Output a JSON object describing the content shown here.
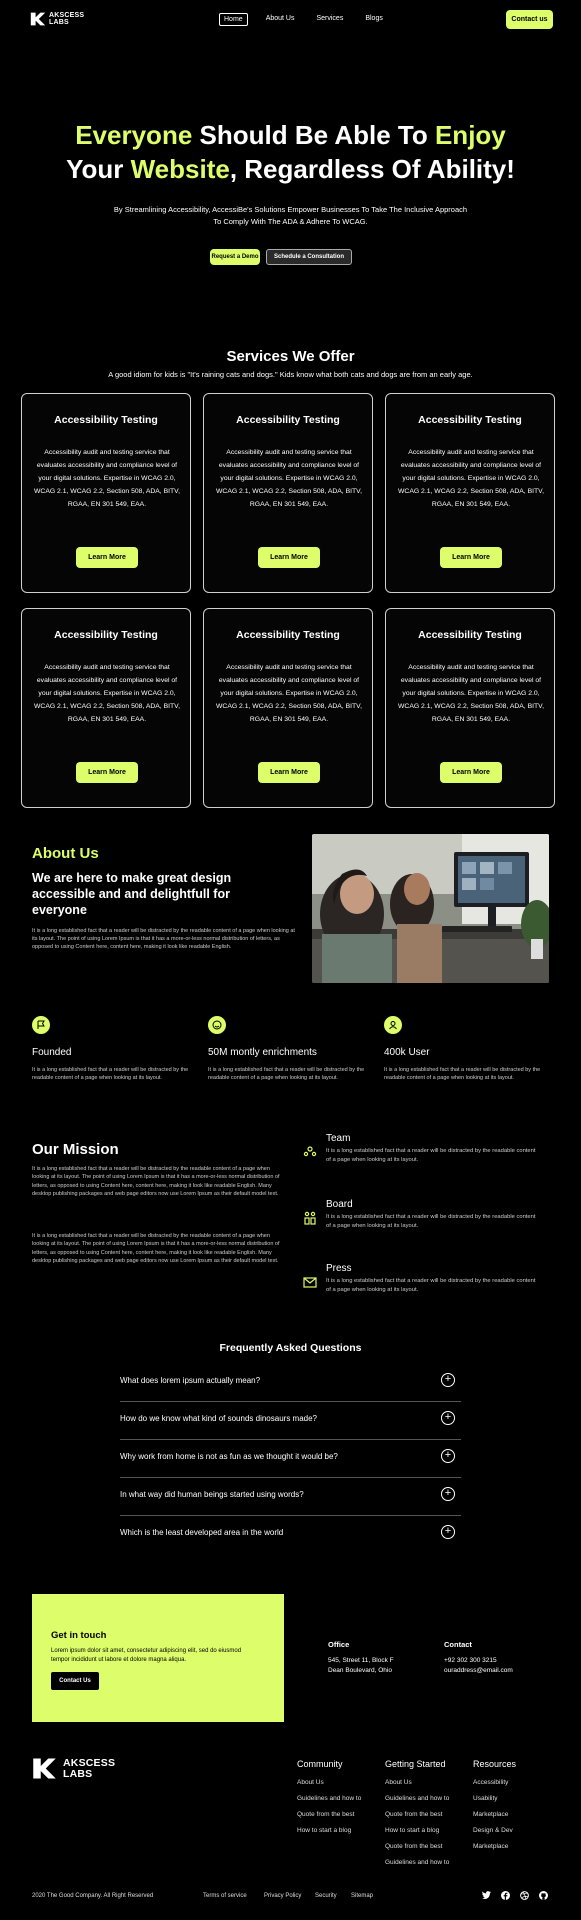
{
  "brand": {
    "line1": "AKSCESS",
    "line2": "LABS"
  },
  "nav": {
    "links": [
      "Home",
      "About Us",
      "Services",
      "Blogs"
    ],
    "contact_label": "Contact us"
  },
  "hero": {
    "line1_a": "Everyone",
    "line1_b": " Should Be Able To ",
    "line1_c": "Enjoy",
    "line2_a": "Your ",
    "line2_b": "Website",
    "line2_c": ", Regardless Of Ability!",
    "subtitle": "By Streamlining Accessibility, AccessiBe's Solutions Empower Businesses To Take The Inclusive Approach To Comply With The ADA & Adhere To WCAG.",
    "demo_label": "Request a Demo",
    "consult_label": "Schedule a Consultation"
  },
  "services": {
    "title": "Services We Offer",
    "subtitle": "A good idiom for kids is \"It's raining cats and dogs.\" Kids know what both cats and dogs are from an early age.",
    "cards": [
      {
        "title": "Accessibility Testing",
        "body": "Accessibility audit and testing service that evaluates accessibility and compliance level of your digital solutions. Expertise in WCAG 2.0, WCAG 2.1, WCAG 2.2, Section 508, ADA, BITV, RGAA, EN 301 549, EAA.",
        "button": "Learn More"
      },
      {
        "title": "Accessibility Testing",
        "body": "Accessibility audit and testing service that evaluates accessibility and compliance level of your digital solutions. Expertise in WCAG 2.0, WCAG 2.1, WCAG 2.2, Section 508, ADA, BITV, RGAA, EN 301 549, EAA.",
        "button": "Learn More"
      },
      {
        "title": "Accessibility Testing",
        "body": "Accessibility audit and testing service that evaluates accessibility and compliance level of your digital solutions. Expertise in WCAG 2.0, WCAG 2.1, WCAG 2.2, Section 508, ADA, BITV, RGAA, EN 301 549, EAA.",
        "button": "Learn More"
      },
      {
        "title": "Accessibility Testing",
        "body": "Accessibility audit and testing service that evaluates accessibility and compliance level of your digital solutions. Expertise in WCAG 2.0, WCAG 2.1, WCAG 2.2, Section 508, ADA, BITV, RGAA, EN 301 549, EAA.",
        "button": "Learn More"
      },
      {
        "title": "Accessibility Testing",
        "body": "Accessibility audit and testing service that evaluates accessibility and compliance level of your digital solutions. Expertise in WCAG 2.0, WCAG 2.1, WCAG 2.2, Section 508, ADA, BITV, RGAA, EN 301 549, EAA.",
        "button": "Learn More"
      },
      {
        "title": "Accessibility Testing",
        "body": "Accessibility audit and testing service that evaluates accessibility and compliance level of your digital solutions. Expertise in WCAG 2.0, WCAG 2.1, WCAG 2.2, Section 508, ADA, BITV, RGAA, EN 301 549, EAA.",
        "button": "Learn More"
      }
    ]
  },
  "about": {
    "heading": "About Us",
    "title": "We are here to make great design accessible and and delightfull for everyone",
    "text": "It is a long established fact that a reader will be distracted by the readable content of a page when looking at its layout. The point of using Lorem Ipsum is that it has a more-or-less normal distribution of letters, as opposed to using Content here, content here, making it look like readable English."
  },
  "stats": [
    {
      "title": "Founded",
      "text": "It is a long established fact that a reader will be distracted by the readable content of a page when looking at its layout."
    },
    {
      "title": "50M montly enrichments",
      "text": "It is a long established fact that a reader will be distracted by the readable content of a page when looking at its layout."
    },
    {
      "title": "400k User",
      "text": "It is a long established fact that a reader will be distracted by the readable content of a page when looking at its layout."
    }
  ],
  "mission": {
    "title": "Our Mission",
    "paragraph1": "It is a long established fact that a reader will be distracted by the readable content of a page when looking at its layout. The point of using Lorem Ipsum is that it has a more-or-less normal distribution of letters, as opposed to using Content here, content here, making it look like readable English. Many desktop publishing packages and web page editors now use Lorem Ipsum as their default model text.",
    "paragraph2": "It is a long established fact that a reader will be distracted by the readable content of a page when looking at its layout. The point of using Lorem Ipsum is that it has a more-or-less normal distribution of letters, as opposed to using Content here, content here, making it look like readable English. Many desktop publishing packages and web page editors now use Lorem Ipsum as their default model text.",
    "features": [
      {
        "title": "Team",
        "text": "It is a long established fact that a reader will be distracted by the readable content of a page when looking at its layout."
      },
      {
        "title": "Board",
        "text": "It is a long established fact that a reader will be distracted by the readable content of a page when looking at its layout."
      },
      {
        "title": "Press",
        "text": "It is a long established fact that a reader will be distracted by the readable content of a page when looking at its layout."
      }
    ]
  },
  "faq": {
    "title": "Frequently Asked Questions",
    "items": [
      "What does lorem ipsum actually mean?",
      "How do we know what kind of sounds dinosaurs made?",
      "Why work from home is not as fun as we thought it would be?",
      "In what way did human beings started using words?",
      "Which is the least developed area in the world"
    ]
  },
  "touch": {
    "title": "Get in touch",
    "text": "Lorem ipsum dolor sit amet, consectetur adipiscing elit, sed do eiusmod tempor incididunt ut labore et dolore magna aliqua.",
    "button": "Contact Us"
  },
  "office": {
    "label": "Office",
    "line1": "545, Street 11, Block F",
    "line2": "Dean Boulevard, Ohio"
  },
  "contact": {
    "label": "Contact",
    "phone": "+92 302 300 3215",
    "email": "ouraddress@email.com"
  },
  "footer": {
    "columns": [
      {
        "title": "Community",
        "items": [
          "About Us",
          "Guidelines and how to",
          "Quote from the best",
          "How to start a blog"
        ]
      },
      {
        "title": "Getting Started",
        "items": [
          "About Us",
          "Guidelines and how to",
          "Quote from the best",
          "How to start a blog",
          "Quote from the best",
          "Guidelines and how to"
        ]
      },
      {
        "title": "Resources",
        "items": [
          "Accessibility",
          "Usability",
          "Marketplace",
          "Design & Dev",
          "Marketplace"
        ]
      }
    ],
    "copyright": "2020 The Good Company. All Right Reserved",
    "links": [
      "Terms of service",
      "Privacy Policy",
      "Security",
      "Sitemap"
    ],
    "social_icons": [
      "twitter-icon",
      "facebook-icon",
      "dribbble-icon",
      "github-icon"
    ]
  },
  "colors": {
    "accent": "#ddfd6a",
    "background": "#000000"
  }
}
